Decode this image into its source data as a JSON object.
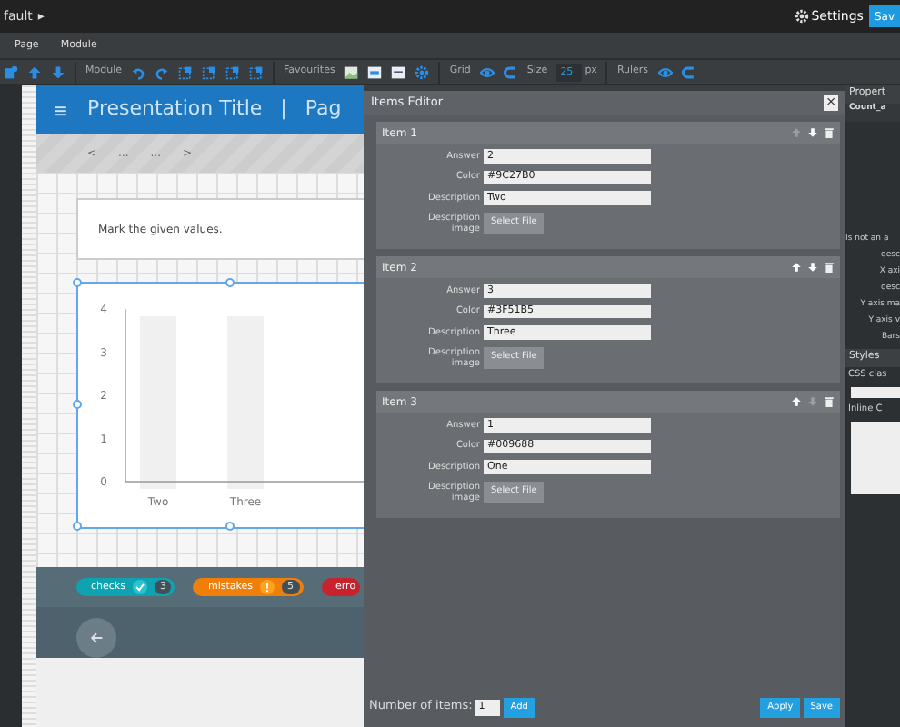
{
  "topbar": {
    "title": "fault",
    "title_icon": "▸",
    "settings": "Settings",
    "save": "Sav"
  },
  "menu": [
    "Page",
    "Module"
  ],
  "toolbar": {
    "module_label": "Module",
    "favourites_label": "Favourites",
    "grid_label": "Grid",
    "size_label": "Size",
    "size_value": "25",
    "size_unit": "px",
    "rulers_label": "Rulers"
  },
  "presentation": {
    "title": "Presentation Title",
    "separator": "|",
    "page": "Pag",
    "nav": [
      "<",
      "...",
      "...",
      ">"
    ],
    "instruction": "Mark the given values.",
    "chart_data": {
      "type": "bar",
      "categories": [
        "Two",
        "Three"
      ],
      "values": [
        null,
        null
      ],
      "ylim": [
        0,
        4
      ],
      "yticks": [
        0,
        1,
        2,
        3,
        4
      ]
    },
    "badges": [
      {
        "kind": "check",
        "label": "checks",
        "count": "3",
        "color": "#0fa3b1"
      },
      {
        "kind": "mistake",
        "label": "mistakes",
        "count": "5",
        "color": "#f07f09"
      },
      {
        "kind": "error",
        "label": "erro",
        "color": "#c8232c"
      }
    ]
  },
  "dialog": {
    "title": "Items Editor",
    "close": "×",
    "items": [
      {
        "title": "Item 1",
        "up_disabled": true,
        "down_disabled": false,
        "fields": [
          {
            "label": "Answer",
            "value": "2"
          },
          {
            "label": "Color",
            "value": "#9C27B0"
          },
          {
            "label": "Description",
            "value": "Two"
          }
        ],
        "image_label": "Description image",
        "file_button": "Select File"
      },
      {
        "title": "Item 2",
        "up_disabled": false,
        "down_disabled": false,
        "fields": [
          {
            "label": "Answer",
            "value": "3"
          },
          {
            "label": "Color",
            "value": "#3F51B5"
          },
          {
            "label": "Description",
            "value": "Three"
          }
        ],
        "image_label": "Description image",
        "file_button": "Select File"
      },
      {
        "title": "Item 3",
        "up_disabled": false,
        "down_disabled": true,
        "fields": [
          {
            "label": "Answer",
            "value": "1"
          },
          {
            "label": "Color",
            "value": "#009688"
          },
          {
            "label": "Description",
            "value": "One"
          }
        ],
        "image_label": "Description image",
        "file_button": "Select File"
      }
    ],
    "count_label": "Number of items:",
    "count_value": "1",
    "add": "Add",
    "apply": "Apply",
    "save": "Save"
  },
  "properties": {
    "title": "Propert",
    "module": "Count_a",
    "labels": [
      "Is not an a",
      "desc",
      "X axi",
      "desc",
      "Y axis ma",
      "Y axis v",
      "Bars"
    ],
    "styles": "Styles",
    "css_label": "CSS clas",
    "inline_label": "Inline C"
  }
}
